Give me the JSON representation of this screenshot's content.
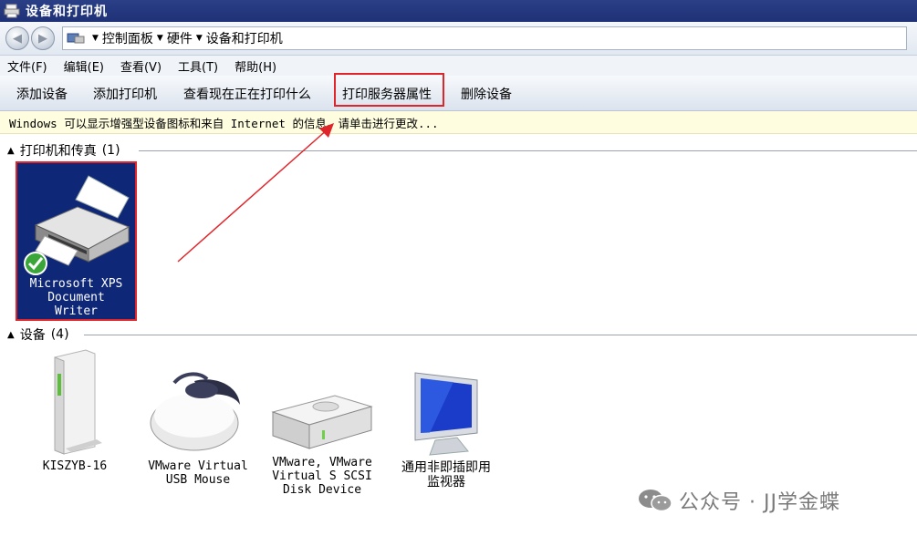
{
  "window": {
    "title": "设备和打印机"
  },
  "address": {
    "crumbs": [
      "控制面板",
      "硬件",
      "设备和打印机"
    ]
  },
  "menu": [
    {
      "label": "文件(F)"
    },
    {
      "label": "编辑(E)"
    },
    {
      "label": "查看(V)"
    },
    {
      "label": "工具(T)"
    },
    {
      "label": "帮助(H)"
    }
  ],
  "commands": [
    {
      "label": "添加设备"
    },
    {
      "label": "添加打印机"
    },
    {
      "label": "查看现在正在打印什么"
    },
    {
      "label": "打印服务器属性"
    },
    {
      "label": "删除设备"
    }
  ],
  "infobar": {
    "text": "Windows 可以显示增强型设备图标和来自 Internet 的信息。请单击进行更改..."
  },
  "groups": {
    "printers": {
      "title": "打印机和传真",
      "count": "(1)"
    },
    "devices": {
      "title": "设备",
      "count": "(4)"
    }
  },
  "printers": [
    {
      "label": "Microsoft XPS\nDocument\nWriter"
    }
  ],
  "devices": [
    {
      "label": "KISZYB-16",
      "icon": "computer-tower-icon"
    },
    {
      "label": "VMware Virtual\nUSB Mouse",
      "icon": "mouse-icon"
    },
    {
      "label": "VMware, VMware\nVirtual S SCSI\nDisk Device",
      "icon": "disk-drive-icon"
    },
    {
      "label": "通用非即插即用\n监视器",
      "icon": "monitor-icon"
    }
  ],
  "watermark": {
    "text": "公众号 · JJ学金蝶"
  },
  "colors": {
    "titlebar": "#1f3177",
    "highlight": "#e0252a",
    "selection": "#0f2777",
    "infobar": "#fefde0"
  }
}
